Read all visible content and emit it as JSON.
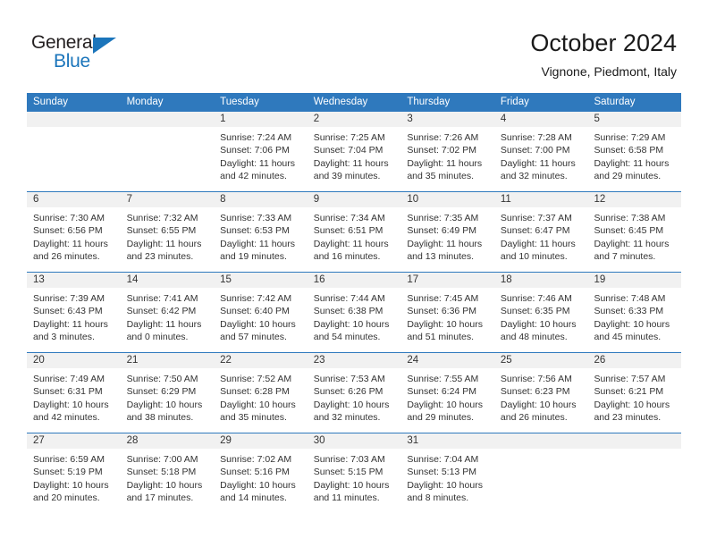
{
  "logo": {
    "word_top": "General",
    "word_bottom": "Blue",
    "triangle_color": "#1b75bb",
    "text_color": "#231f20",
    "blue_color": "#1b75bb"
  },
  "header": {
    "title": "October 2024",
    "subtitle": "Vignone, Piedmont, Italy"
  },
  "theme": {
    "header_blue": "#2f79bd",
    "date_band_gray": "#f1f1f1",
    "text": "#333333"
  },
  "calendar": {
    "day_headers": [
      "Sunday",
      "Monday",
      "Tuesday",
      "Wednesday",
      "Thursday",
      "Friday",
      "Saturday"
    ],
    "weeks": [
      {
        "dates": [
          "",
          "",
          "1",
          "2",
          "3",
          "4",
          "5"
        ],
        "cells": [
          {
            "empty": true,
            "sunrise": "",
            "sunset": "",
            "daylight1": "",
            "daylight2": ""
          },
          {
            "empty": true,
            "sunrise": "",
            "sunset": "",
            "daylight1": "",
            "daylight2": ""
          },
          {
            "empty": false,
            "sunrise": "Sunrise: 7:24 AM",
            "sunset": "Sunset: 7:06 PM",
            "daylight1": "Daylight: 11 hours",
            "daylight2": "and 42 minutes."
          },
          {
            "empty": false,
            "sunrise": "Sunrise: 7:25 AM",
            "sunset": "Sunset: 7:04 PM",
            "daylight1": "Daylight: 11 hours",
            "daylight2": "and 39 minutes."
          },
          {
            "empty": false,
            "sunrise": "Sunrise: 7:26 AM",
            "sunset": "Sunset: 7:02 PM",
            "daylight1": "Daylight: 11 hours",
            "daylight2": "and 35 minutes."
          },
          {
            "empty": false,
            "sunrise": "Sunrise: 7:28 AM",
            "sunset": "Sunset: 7:00 PM",
            "daylight1": "Daylight: 11 hours",
            "daylight2": "and 32 minutes."
          },
          {
            "empty": false,
            "sunrise": "Sunrise: 7:29 AM",
            "sunset": "Sunset: 6:58 PM",
            "daylight1": "Daylight: 11 hours",
            "daylight2": "and 29 minutes."
          }
        ]
      },
      {
        "dates": [
          "6",
          "7",
          "8",
          "9",
          "10",
          "11",
          "12"
        ],
        "cells": [
          {
            "empty": false,
            "sunrise": "Sunrise: 7:30 AM",
            "sunset": "Sunset: 6:56 PM",
            "daylight1": "Daylight: 11 hours",
            "daylight2": "and 26 minutes."
          },
          {
            "empty": false,
            "sunrise": "Sunrise: 7:32 AM",
            "sunset": "Sunset: 6:55 PM",
            "daylight1": "Daylight: 11 hours",
            "daylight2": "and 23 minutes."
          },
          {
            "empty": false,
            "sunrise": "Sunrise: 7:33 AM",
            "sunset": "Sunset: 6:53 PM",
            "daylight1": "Daylight: 11 hours",
            "daylight2": "and 19 minutes."
          },
          {
            "empty": false,
            "sunrise": "Sunrise: 7:34 AM",
            "sunset": "Sunset: 6:51 PM",
            "daylight1": "Daylight: 11 hours",
            "daylight2": "and 16 minutes."
          },
          {
            "empty": false,
            "sunrise": "Sunrise: 7:35 AM",
            "sunset": "Sunset: 6:49 PM",
            "daylight1": "Daylight: 11 hours",
            "daylight2": "and 13 minutes."
          },
          {
            "empty": false,
            "sunrise": "Sunrise: 7:37 AM",
            "sunset": "Sunset: 6:47 PM",
            "daylight1": "Daylight: 11 hours",
            "daylight2": "and 10 minutes."
          },
          {
            "empty": false,
            "sunrise": "Sunrise: 7:38 AM",
            "sunset": "Sunset: 6:45 PM",
            "daylight1": "Daylight: 11 hours",
            "daylight2": "and 7 minutes."
          }
        ]
      },
      {
        "dates": [
          "13",
          "14",
          "15",
          "16",
          "17",
          "18",
          "19"
        ],
        "cells": [
          {
            "empty": false,
            "sunrise": "Sunrise: 7:39 AM",
            "sunset": "Sunset: 6:43 PM",
            "daylight1": "Daylight: 11 hours",
            "daylight2": "and 3 minutes."
          },
          {
            "empty": false,
            "sunrise": "Sunrise: 7:41 AM",
            "sunset": "Sunset: 6:42 PM",
            "daylight1": "Daylight: 11 hours",
            "daylight2": "and 0 minutes."
          },
          {
            "empty": false,
            "sunrise": "Sunrise: 7:42 AM",
            "sunset": "Sunset: 6:40 PM",
            "daylight1": "Daylight: 10 hours",
            "daylight2": "and 57 minutes."
          },
          {
            "empty": false,
            "sunrise": "Sunrise: 7:44 AM",
            "sunset": "Sunset: 6:38 PM",
            "daylight1": "Daylight: 10 hours",
            "daylight2": "and 54 minutes."
          },
          {
            "empty": false,
            "sunrise": "Sunrise: 7:45 AM",
            "sunset": "Sunset: 6:36 PM",
            "daylight1": "Daylight: 10 hours",
            "daylight2": "and 51 minutes."
          },
          {
            "empty": false,
            "sunrise": "Sunrise: 7:46 AM",
            "sunset": "Sunset: 6:35 PM",
            "daylight1": "Daylight: 10 hours",
            "daylight2": "and 48 minutes."
          },
          {
            "empty": false,
            "sunrise": "Sunrise: 7:48 AM",
            "sunset": "Sunset: 6:33 PM",
            "daylight1": "Daylight: 10 hours",
            "daylight2": "and 45 minutes."
          }
        ]
      },
      {
        "dates": [
          "20",
          "21",
          "22",
          "23",
          "24",
          "25",
          "26"
        ],
        "cells": [
          {
            "empty": false,
            "sunrise": "Sunrise: 7:49 AM",
            "sunset": "Sunset: 6:31 PM",
            "daylight1": "Daylight: 10 hours",
            "daylight2": "and 42 minutes."
          },
          {
            "empty": false,
            "sunrise": "Sunrise: 7:50 AM",
            "sunset": "Sunset: 6:29 PM",
            "daylight1": "Daylight: 10 hours",
            "daylight2": "and 38 minutes."
          },
          {
            "empty": false,
            "sunrise": "Sunrise: 7:52 AM",
            "sunset": "Sunset: 6:28 PM",
            "daylight1": "Daylight: 10 hours",
            "daylight2": "and 35 minutes."
          },
          {
            "empty": false,
            "sunrise": "Sunrise: 7:53 AM",
            "sunset": "Sunset: 6:26 PM",
            "daylight1": "Daylight: 10 hours",
            "daylight2": "and 32 minutes."
          },
          {
            "empty": false,
            "sunrise": "Sunrise: 7:55 AM",
            "sunset": "Sunset: 6:24 PM",
            "daylight1": "Daylight: 10 hours",
            "daylight2": "and 29 minutes."
          },
          {
            "empty": false,
            "sunrise": "Sunrise: 7:56 AM",
            "sunset": "Sunset: 6:23 PM",
            "daylight1": "Daylight: 10 hours",
            "daylight2": "and 26 minutes."
          },
          {
            "empty": false,
            "sunrise": "Sunrise: 7:57 AM",
            "sunset": "Sunset: 6:21 PM",
            "daylight1": "Daylight: 10 hours",
            "daylight2": "and 23 minutes."
          }
        ]
      },
      {
        "dates": [
          "27",
          "28",
          "29",
          "30",
          "31",
          "",
          ""
        ],
        "cells": [
          {
            "empty": false,
            "sunrise": "Sunrise: 6:59 AM",
            "sunset": "Sunset: 5:19 PM",
            "daylight1": "Daylight: 10 hours",
            "daylight2": "and 20 minutes."
          },
          {
            "empty": false,
            "sunrise": "Sunrise: 7:00 AM",
            "sunset": "Sunset: 5:18 PM",
            "daylight1": "Daylight: 10 hours",
            "daylight2": "and 17 minutes."
          },
          {
            "empty": false,
            "sunrise": "Sunrise: 7:02 AM",
            "sunset": "Sunset: 5:16 PM",
            "daylight1": "Daylight: 10 hours",
            "daylight2": "and 14 minutes."
          },
          {
            "empty": false,
            "sunrise": "Sunrise: 7:03 AM",
            "sunset": "Sunset: 5:15 PM",
            "daylight1": "Daylight: 10 hours",
            "daylight2": "and 11 minutes."
          },
          {
            "empty": false,
            "sunrise": "Sunrise: 7:04 AM",
            "sunset": "Sunset: 5:13 PM",
            "daylight1": "Daylight: 10 hours",
            "daylight2": "and 8 minutes."
          },
          {
            "empty": true,
            "sunrise": "",
            "sunset": "",
            "daylight1": "",
            "daylight2": ""
          },
          {
            "empty": true,
            "sunrise": "",
            "sunset": "",
            "daylight1": "",
            "daylight2": ""
          }
        ]
      }
    ]
  }
}
